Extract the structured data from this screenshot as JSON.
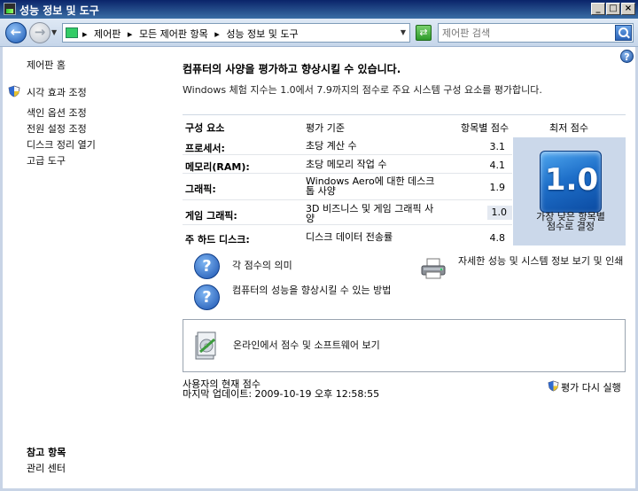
{
  "window": {
    "title": "성능 정보 및 도구",
    "buttons": {
      "minimize": "_",
      "maximize": "□",
      "close": "×"
    }
  },
  "nav": {
    "breadcrumbs": [
      "제어판",
      "모든 제어판 항목",
      "성능 정보 및 도구"
    ],
    "search_placeholder": "제어판 검색",
    "icons": [
      "back-arrow-icon",
      "forward-arrow-icon",
      "control-panel-icon",
      "refresh-icon",
      "search-icon"
    ]
  },
  "sidebar": {
    "home": "제어판 홈",
    "links": [
      "시각 효과 조정",
      "색인 옵션 조정",
      "전원 설정 조정",
      "디스크 정리 열기",
      "고급 도구"
    ],
    "see_also_title": "참고 항목",
    "see_also_links": [
      "관리 센터"
    ]
  },
  "main": {
    "heading": "컴퓨터의 사양을 평가하고 향상시킬 수 있습니다.",
    "description": "Windows 체험 지수는 1.0에서 7.9까지의 점수로 주요 시스템 구성 요소를 평가합니다.",
    "table": {
      "headers": {
        "component": "구성 요소",
        "rating": "평가 기준",
        "subscore": "항목별 점수",
        "base": "최저 점수"
      },
      "rows": [
        {
          "component": "프로세서:",
          "rating": "초당 계산 수",
          "subscore": "3.1"
        },
        {
          "component": "메모리(RAM):",
          "rating": "초당 메모리 작업 수",
          "subscore": "4.1"
        },
        {
          "component": "그래픽:",
          "rating": "Windows Aero에 대한 데스크톱 사양",
          "subscore": "1.9"
        },
        {
          "component": "게임 그래픽:",
          "rating": "3D 비즈니스 및 게임 그래픽 사양",
          "subscore": "1.0"
        },
        {
          "component": "주 하드 디스크:",
          "rating": "디스크 데이터 전송률",
          "subscore": "4.8"
        }
      ],
      "base_score": "1.0",
      "base_caption": "가장 낮은 항목별 점수로 결정"
    },
    "links": {
      "meaning": "각 점수의 의미",
      "improve": "컴퓨터의 성능을 향상시킬 수 있는 방법",
      "details": "자세한 성능 및 시스템 정보 보기 및 인쇄",
      "online": "온라인에서 점수 및 소프트웨어 보기"
    },
    "footer": {
      "current_label": "사용자의 현재 점수",
      "last_updated": "마지막 업데이트: 2009-10-19 오후 12:58:55",
      "rerun": "평가 다시 실행"
    }
  },
  "colors": {
    "accent": "#1e6fc9",
    "panel": "#cbd8ea",
    "titlebar": "#0a246a"
  }
}
